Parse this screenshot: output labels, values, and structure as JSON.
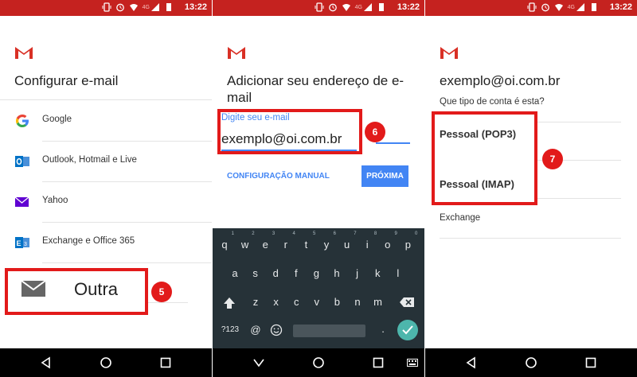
{
  "status": {
    "time": "13:22",
    "network": "4G"
  },
  "screen1": {
    "title": "Configurar e-mail",
    "providers": [
      {
        "label": "Google",
        "icon": "google-icon"
      },
      {
        "label": "Outlook, Hotmail e Live",
        "icon": "outlook-icon"
      },
      {
        "label": "Yahoo",
        "icon": "yahoo-icon"
      },
      {
        "label": "Exchange e Office 365",
        "icon": "exchange-icon"
      }
    ],
    "other_label": "Outra",
    "step_badge": "5"
  },
  "screen2": {
    "title_line1": "Adicionar seu endereço de e-",
    "title_line2": "mail",
    "field_label": "Digite seu e-mail",
    "field_value": "exemplo@oi.com.br",
    "manual_config_label": "CONFIGURAÇÃO MANUAL",
    "next_label": "PRÓXIMA",
    "step_badge": "6",
    "keyboard": {
      "row1": [
        "q",
        "w",
        "e",
        "r",
        "t",
        "y",
        "u",
        "i",
        "o",
        "p"
      ],
      "row1_numbers": [
        "1",
        "2",
        "3",
        "4",
        "5",
        "6",
        "7",
        "8",
        "9",
        "0"
      ],
      "row2": [
        "a",
        "s",
        "d",
        "f",
        "g",
        "h",
        "j",
        "k",
        "l"
      ],
      "row3": [
        "z",
        "x",
        "c",
        "v",
        "b",
        "n",
        "m"
      ],
      "symbols_label": "?123",
      "at_label": "@",
      "period_label": "."
    }
  },
  "screen3": {
    "email": "exemplo@oi.com.br",
    "question": "Que tipo de conta é esta?",
    "options": [
      "Pessoal (POP3)",
      "Pessoal (IMAP)",
      "Exchange"
    ],
    "step_badge": "7"
  },
  "colors": {
    "status_red": "#c5221f",
    "accent_blue": "#4285f4",
    "annotation_red": "#e21a1a",
    "keyboard_bg": "#263238"
  }
}
